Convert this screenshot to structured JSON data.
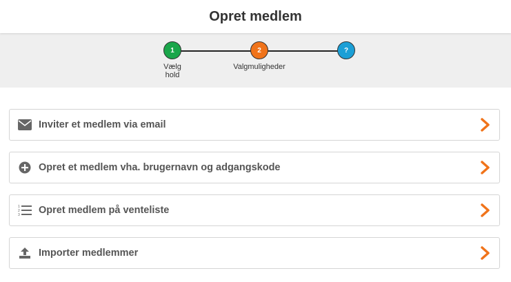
{
  "header": {
    "title": "Opret medlem"
  },
  "stepper": {
    "steps": [
      {
        "number": "1",
        "label": "Vælg\nhold",
        "color": "#1aa64a"
      },
      {
        "number": "2",
        "label": "Valgmuligheder",
        "color": "#f0731a"
      },
      {
        "number": "?",
        "label": "",
        "color": "#1b9fd6"
      }
    ]
  },
  "options": [
    {
      "label": "Inviter et medlem via email",
      "icon": "envelope-icon"
    },
    {
      "label": "Opret et medlem vha. brugernavn og adgangskode",
      "icon": "plus-circle-icon"
    },
    {
      "label": "Opret medlem på venteliste",
      "icon": "numbered-list-icon"
    },
    {
      "label": "Importer medlemmer",
      "icon": "upload-icon"
    }
  ],
  "colors": {
    "accent": "#f0731a",
    "icon": "#666666"
  }
}
